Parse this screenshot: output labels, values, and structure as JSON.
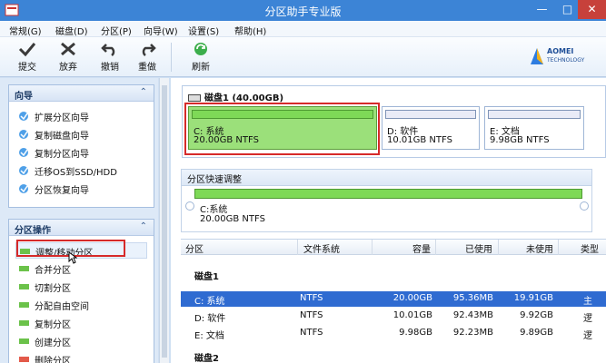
{
  "window": {
    "title": "分区助手专业版",
    "min": "—",
    "max": "□",
    "close": "✕"
  },
  "menu": [
    "常规(G)",
    "磁盘(D)",
    "分区(P)",
    "向导(W)",
    "设置(S)",
    "帮助(H)"
  ],
  "toolbar": {
    "commit": "提交",
    "discard": "放弃",
    "undo": "撤销",
    "redo": "重做",
    "refresh": "刷新"
  },
  "logo": {
    "line1": "AOMEI",
    "line2": "TECHNOLOGY"
  },
  "sidebar": {
    "wizard": {
      "title": "向导",
      "collapse": "⌃",
      "items": [
        "扩展分区向导",
        "复制磁盘向导",
        "复制分区向导",
        "迁移OS到SSD/HDD",
        "分区恢复向导"
      ]
    },
    "ops": {
      "title": "分区操作",
      "collapse": "⌃",
      "items": [
        "调整/移动分区",
        "合并分区",
        "切割分区",
        "分配自由空间",
        "复制分区",
        "创建分区",
        "删除分区"
      ]
    }
  },
  "disk": {
    "header": "磁盘1 (40.00GB)",
    "partitions": [
      {
        "name": "C: 系统",
        "size": "20.00GB NTFS"
      },
      {
        "name": "D: 软件",
        "size": "10.01GB NTFS"
      },
      {
        "name": "E: 文档",
        "size": "9.98GB NTFS"
      }
    ]
  },
  "quick_adjust": {
    "title": "分区快速调整",
    "name": "C:系统",
    "size": "20.00GB NTFS"
  },
  "table": {
    "columns": [
      "分区",
      "文件系统",
      "容量",
      "已使用",
      "未使用",
      "类型"
    ],
    "group1": "磁盘1",
    "group2": "磁盘2",
    "rows": [
      {
        "name": "C: 系统",
        "fs": "NTFS",
        "cap": "20.00GB",
        "used": "95.36MB",
        "free": "19.91GB",
        "type": "主"
      },
      {
        "name": "D: 软件",
        "fs": "NTFS",
        "cap": "10.01GB",
        "used": "92.43MB",
        "free": "9.92GB",
        "type": "逻"
      },
      {
        "name": "E: 文档",
        "fs": "NTFS",
        "cap": "9.98GB",
        "used": "92.23MB",
        "free": "9.89GB",
        "type": "逻"
      }
    ]
  },
  "colors": {
    "accent": "#3c84d6",
    "selected_row": "#2f6bd1",
    "partition_c": "#7ed957",
    "partition_other": "#e9ebf7",
    "highlight_box": "#d62a2a"
  }
}
